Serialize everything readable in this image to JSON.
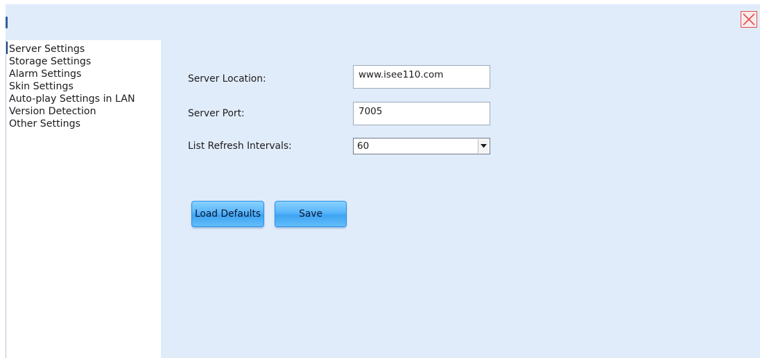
{
  "window": {
    "close_icon": "close-x-icon"
  },
  "sidebar": {
    "items": [
      {
        "label": "Server Settings"
      },
      {
        "label": "Storage Settings"
      },
      {
        "label": "Alarm Settings"
      },
      {
        "label": "Skin Settings"
      },
      {
        "label": "Auto-play Settings in LAN"
      },
      {
        "label": "Version Detection"
      },
      {
        "label": "Other Settings"
      }
    ],
    "selected": "Server Settings"
  },
  "form": {
    "server_location": {
      "label": "Server Location:",
      "value": "www.isee110.com"
    },
    "server_port": {
      "label": "Server Port:",
      "value": "7005"
    },
    "refresh_interval": {
      "label": "List Refresh Intervals:",
      "value": "60"
    }
  },
  "buttons": {
    "load_defaults": "Load Defaults",
    "save": "Save"
  },
  "colors": {
    "panel_background": "#e1ecfb",
    "button_blue": "#58b6fb",
    "close_red": "#e24b4b"
  }
}
